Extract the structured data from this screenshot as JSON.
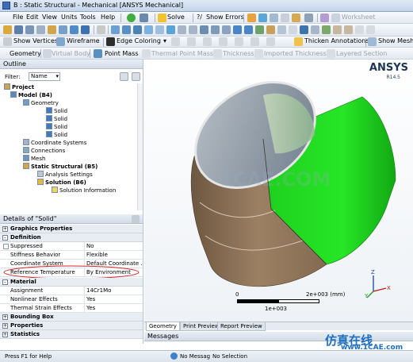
{
  "window": {
    "title": "B : Static Structural - Mechanical [ANSYS Mechanical]"
  },
  "menu": [
    "File",
    "Edit",
    "View",
    "Units",
    "Tools",
    "Help"
  ],
  "toolbar1": {
    "solve_label": "Solve",
    "show_errors_label": "Show Errors",
    "worksheet_label": "Worksheet"
  },
  "toolbar2": {
    "show_vertices": "Show Vertices",
    "wireframe": "Wireframe",
    "edge_coloring": "Edge Coloring",
    "thicken_annotations": "Thicken Annotations",
    "show_mesh": "Show Mesh"
  },
  "toolbar3": {
    "geometry": "Geometry",
    "virtual_body": "Virtual Body",
    "point_mass": "Point Mass",
    "thermal_point_mass": "Thermal Point Mass",
    "thickness": "Thickness",
    "imported_thickness": "Imported Thickness",
    "layered_section": "Layered Section"
  },
  "outline": {
    "header": "Outline",
    "filter_label": "Filter:",
    "filter_value": "Name",
    "tree": [
      "Project",
      "Model (B4)",
      "Geometry",
      "Solid",
      "Solid",
      "Solid",
      "Solid",
      "Coordinate Systems",
      "Connections",
      "Mesh",
      "Static Structural (B5)",
      "Analysis Settings",
      "Solution (B6)",
      "Solution Information"
    ]
  },
  "details": {
    "header": "Details of \"Solid\"",
    "sections": {
      "graphics": "Graphics Properties",
      "definition": "Definition",
      "material": "Material",
      "bounding_box": "Bounding Box",
      "properties": "Properties",
      "statistics": "Statistics"
    },
    "definition_rows": [
      {
        "k": "Suppressed",
        "v": "No"
      },
      {
        "k": "Stiffness Behavior",
        "v": "Flexible"
      },
      {
        "k": "Coordinate System",
        "v": "Default Coordinate ..."
      },
      {
        "k": "Reference Temperature",
        "v": "By Environment"
      }
    ],
    "material_rows": [
      {
        "k": "Assignment",
        "v": "14Cr1Mo"
      },
      {
        "k": "Nonlinear Effects",
        "v": "Yes"
      },
      {
        "k": "Thermal Strain Effects",
        "v": "Yes"
      }
    ]
  },
  "viewport": {
    "brand": "ANSYS",
    "version": "R14.5",
    "watermark": "1CAE.COM",
    "scale_zero": "0",
    "scale_max": "2e+003 (mm)",
    "scale_mid": "1e+003",
    "axis_x": "X",
    "axis_y": "Y",
    "axis_z": "Z",
    "shell_green": "#22dd22",
    "shell_brown": "#8a6e52"
  },
  "view_tabs": [
    "Geometry",
    "Print Preview",
    "Report Preview"
  ],
  "messages": {
    "header": "Messages"
  },
  "status": {
    "help": "Press F1 for Help",
    "messages": "No Messag",
    "selection": "No Selection"
  },
  "watermark_site": {
    "cn": "仿真在线",
    "url": "www.1CAE.com"
  }
}
